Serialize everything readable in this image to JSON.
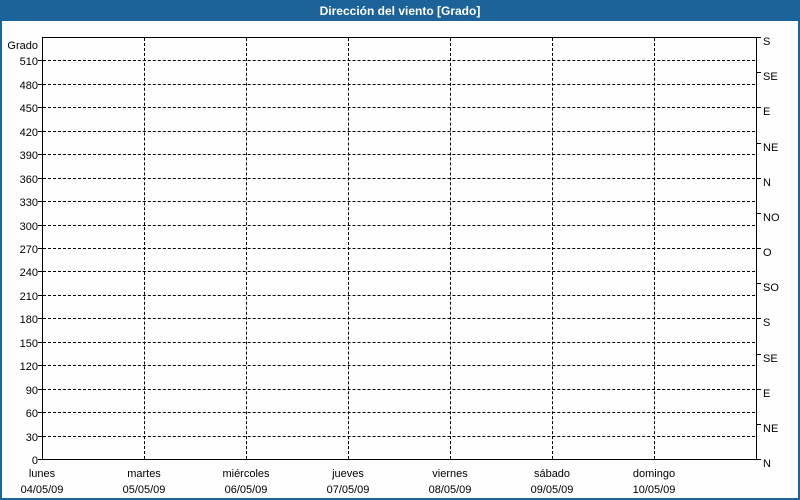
{
  "header": {
    "title": "Dirección del viento [Grado]"
  },
  "colors": {
    "frame_blue": "#1B6398",
    "plot_background": "#FDFEFD",
    "grid": "#000000",
    "axis_text": "#000000",
    "title_text": "#FFFFFF"
  },
  "chart_data": {
    "type": "line",
    "title": "Dirección del viento [Grado]",
    "ylabel": "Grado",
    "ylim": [
      0,
      540
    ],
    "grid": "dashed",
    "legend": "none",
    "y_left_ticks": [
      0,
      30,
      60,
      90,
      120,
      150,
      180,
      210,
      240,
      270,
      300,
      330,
      360,
      390,
      420,
      450,
      480,
      510
    ],
    "y_right_ticks": [
      {
        "deg": 540,
        "label": "S"
      },
      {
        "deg": 495,
        "label": "SE"
      },
      {
        "deg": 450,
        "label": "E"
      },
      {
        "deg": 405,
        "label": "NE"
      },
      {
        "deg": 360,
        "label": "N"
      },
      {
        "deg": 315,
        "label": "NO"
      },
      {
        "deg": 270,
        "label": "O"
      },
      {
        "deg": 225,
        "label": "SO"
      },
      {
        "deg": 180,
        "label": "S"
      },
      {
        "deg": 135,
        "label": "SE"
      },
      {
        "deg": 90,
        "label": "E"
      },
      {
        "deg": 45,
        "label": "NE"
      },
      {
        "deg": 0,
        "label": "N"
      }
    ],
    "x_days": [
      {
        "name": "lunes",
        "date": "04/05/09"
      },
      {
        "name": "martes",
        "date": "05/05/09"
      },
      {
        "name": "miércoles",
        "date": "06/05/09"
      },
      {
        "name": "jueves",
        "date": "07/05/09"
      },
      {
        "name": "viernes",
        "date": "08/05/09"
      },
      {
        "name": "sábado",
        "date": "09/05/09"
      },
      {
        "name": "domingo",
        "date": "10/05/09"
      }
    ],
    "series": []
  }
}
